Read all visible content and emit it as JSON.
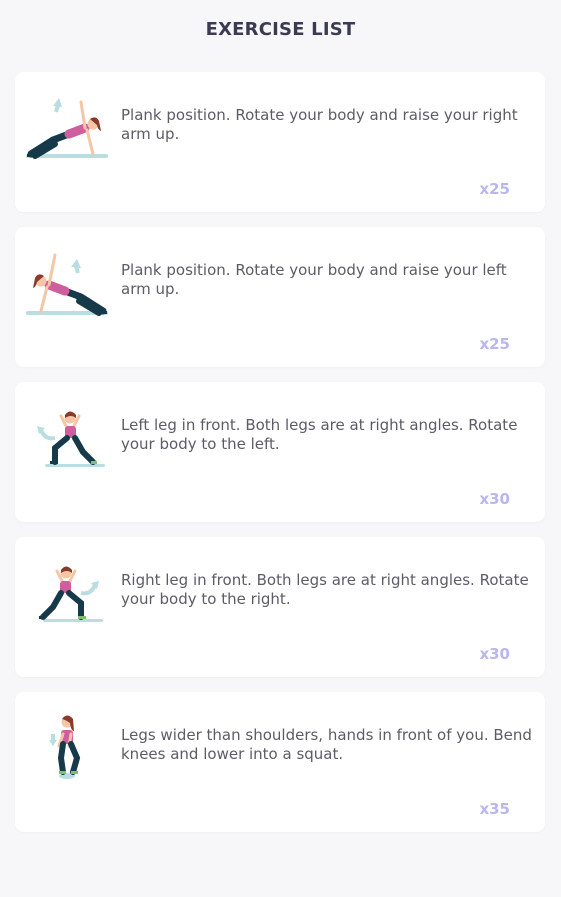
{
  "header": {
    "title": "EXERCISE LIST"
  },
  "exercises": [
    {
      "illustration": "side-plank-right-arm-illustration",
      "description": "Plank position. Rotate your body and raise your right arm up.",
      "reps": "x25"
    },
    {
      "illustration": "side-plank-left-arm-illustration",
      "description": "Plank position. Rotate your body and raise your left arm up.",
      "reps": "x25"
    },
    {
      "illustration": "lunge-twist-left-illustration",
      "description": "Left leg in front. Both legs are at right angles. Rotate your body to the left.",
      "reps": "x30"
    },
    {
      "illustration": "lunge-twist-right-illustration",
      "description": "Right leg in front. Both legs are at right angles. Rotate your body to the right.",
      "reps": "x30"
    },
    {
      "illustration": "squat-illustration",
      "description": "Legs wider than shoulders, hands in front of you. Bend knees and lower into a squat.",
      "reps": "x35"
    }
  ],
  "colors": {
    "accent": "#b9b6f0",
    "title": "#3a3a52",
    "pants": "#163a4a",
    "top": "#cf5e9d",
    "hair": "#8a3a28",
    "skin": "#f4c6a6",
    "mat": "#b9dde0"
  }
}
